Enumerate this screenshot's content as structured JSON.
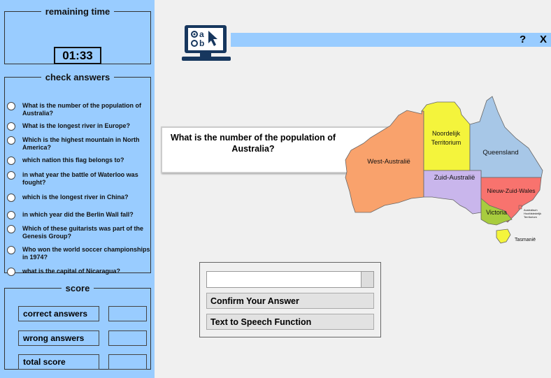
{
  "timer": {
    "title": "remaining time",
    "value": "01:33"
  },
  "check_answers": {
    "title": "check answers",
    "questions": [
      "What is the number of the population of Australia?",
      "What is the longest river in Europe?",
      "Which is the highest mountain in North America?",
      "which nation this flag belongs to?",
      "in what year the battle of Waterloo was fought?",
      "which is the longest river in China?",
      "in which year did the Berlin Wall fall?",
      "Which of these guitarists was part of the Genesis Group?",
      "Who won the world soccer championships in 1974?",
      "what is the capital of Nicaragua?"
    ]
  },
  "score": {
    "title": "score",
    "correct_label": "correct answers",
    "wrong_label": "wrong answers",
    "total_label": "total score"
  },
  "toolbar": {
    "help": "?",
    "close": "X"
  },
  "logo": {
    "letters": [
      "a",
      "b"
    ]
  },
  "question": {
    "text": "What is the number of the population of Australia?"
  },
  "map": {
    "regions": [
      "West-Australië",
      "Noordelijk Territorium",
      "Queensland",
      "Zuid-Australië",
      "Nieuw-Zuid-Wales",
      "Victoria",
      "Australisch Hoofdstedelijk Territorium",
      "Tasmanië"
    ]
  },
  "answer": {
    "input_value": "",
    "confirm_label": "Confirm Your Answer",
    "tts_label": "Text to Speech Function"
  },
  "colors": {
    "panel": "#99ccff",
    "wa": "#f9a26c",
    "nt": "#f4f43c",
    "qld": "#a7c7e7",
    "sa": "#c9b6ec",
    "nsw": "#f8736e",
    "vic": "#a8cc3e",
    "tas": "#f4f43c"
  }
}
